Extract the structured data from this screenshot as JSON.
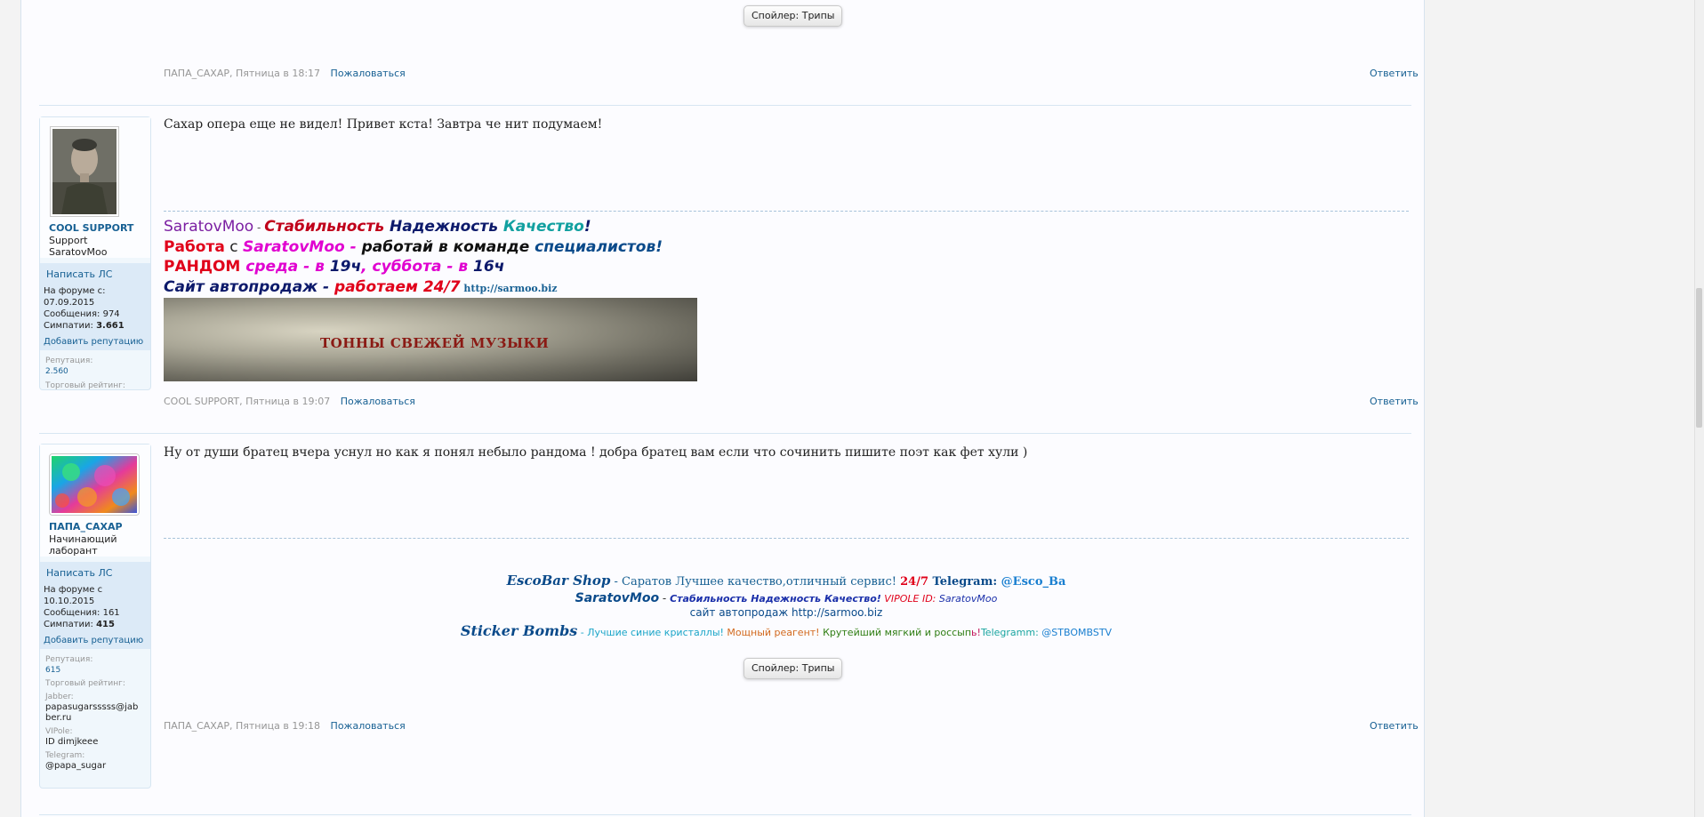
{
  "post1_tail": {
    "spoiler_label": "Спойлер: Трипы",
    "author": "ПАПА_САХАР",
    "date": ", Пятница в 18:17",
    "report": "Пожаловаться",
    "reply": "Ответить"
  },
  "post2": {
    "author": {
      "name": "COOL SUPPORT",
      "title": "Support SaratovMoo",
      "pm": "Написать ЛС",
      "since_label": "На форуме с:",
      "since_value": "07.09.2015",
      "messages_label": "Сообщения:",
      "messages_value": "974",
      "likes_label": "Симпатии:",
      "likes_value": "3.661",
      "add_rep": "Добавить репутацию",
      "rep_label": "Репутация:",
      "rep_value": "2.560",
      "trade_label": "Торговый рейтинг:"
    },
    "text": "Сахар опера еще не видел! Привет кста! Завтра че нит подумаем!",
    "signature": {
      "l1": [
        "SaratovMoo",
        " - ",
        "Стабильность",
        " Надежность ",
        "Качество",
        "!"
      ],
      "l2": [
        "Работа",
        " с ",
        "SaratovMoo",
        " - ",
        "работай в команде",
        " специалистов!"
      ],
      "l3": [
        "РАНДОМ",
        " среда - в ",
        "19ч",
        ", суббота - в ",
        "16ч"
      ],
      "l4": [
        "Сайт автопродаж - ",
        "работаем 24/7",
        " http://sarmoo.biz"
      ],
      "banner": "ТОННЫ СВЕЖЕЙ МУЗЫКИ"
    },
    "meta_author": "COOL SUPPORT",
    "meta_date": ", Пятница в 19:07",
    "report": "Пожаловаться",
    "reply": "Ответить"
  },
  "post3": {
    "author": {
      "name": "ПАПА_САХАР",
      "title": "Начинающий лаборант",
      "pm": "Написать ЛС",
      "since_label": "На форуме с",
      "since_value": "10.10.2015",
      "messages_label": "Сообщения:",
      "messages_value": "161",
      "likes_label": "Симпатии:",
      "likes_value": "415",
      "add_rep": "Добавить репутацию",
      "rep_label": "Репутация:",
      "rep_value": "615",
      "trade_label": "Торговый рейтинг:",
      "jabber_label": "Jabber:",
      "jabber_value": "papasugarsssss@jabber.ru",
      "vipole_label": "VIPole:",
      "vipole_value": "ID dimjkeee",
      "telegram_label": "Telegram:",
      "telegram_value": "@papa_sugar"
    },
    "text": "Ну от души братец вчера уснул но как я понял небыло рандома ! добра братец вам если что сочинить пишите поэт как фет хули )",
    "signature": {
      "l1": [
        "EscoBar Shop",
        " - Саратов Лучшее качество,отличный сервис! ",
        "24/7",
        " Telegram: ",
        "@Esco_Ba"
      ],
      "l2": [
        "SaratovMoo",
        " - ",
        "Стабильность Надежность Качество!",
        " VIPOLE ID: ",
        "SaratovMoo"
      ],
      "l3": "сайт автопродаж http://sarmoo.biz",
      "l4": [
        "Sticker Bombs",
        " - ",
        "Лучшие синие кристаллы!",
        " Мощный реагент!",
        " Крутейший мягкий и россып",
        "ь!",
        "Telegramm: ",
        "@STBOMBSTV"
      ]
    },
    "spoiler_label": "Спойлер: Трипы",
    "meta_author": "ПАПА_САХАР",
    "meta_date": ", Пятница в 19:18",
    "report": "Пожаловаться",
    "reply": "Ответить"
  }
}
